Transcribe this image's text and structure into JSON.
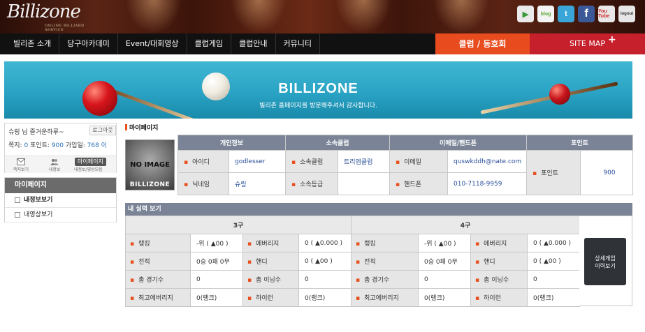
{
  "header": {
    "logo_text": "Billizone",
    "logo_sub": "ONLINE BILLIARD SERVICE",
    "social": [
      {
        "name": "play-store-icon",
        "glyph": "▶"
      },
      {
        "name": "blog-icon",
        "glyph": "blog"
      },
      {
        "name": "twitter-icon",
        "glyph": "t"
      },
      {
        "name": "facebook-icon",
        "glyph": "f"
      },
      {
        "name": "youtube-icon",
        "glyph": "You Tube"
      },
      {
        "name": "logout-icon",
        "glyph": "logout"
      }
    ]
  },
  "nav": {
    "items": [
      "빌리존 소개",
      "당구아카데미",
      "Event/대회영상",
      "클럽게임",
      "클럽안내",
      "커뮤니티"
    ],
    "club": "클럽 / 동호회",
    "sitemap": "SITE MAP",
    "sitemap_plus": "+"
  },
  "banner": {
    "title": "BILLIZONE",
    "subtitle": "빌리존 홈페이지를 방문해주셔서 감사합니다."
  },
  "user": {
    "greeting": "슈링 님 즐거운하루~",
    "logout": "로그아웃",
    "note_label": "쪽지:",
    "note_count": "0",
    "point_label": "포인트:",
    "point": "900",
    "join_label": "가입일:",
    "join_date": "768 이",
    "tools": [
      "쪽지보기",
      "내정보",
      "마이페이지"
    ],
    "mypage_sub": "내정보/영상모음"
  },
  "sidemenu": {
    "head": "마이페이지",
    "items": [
      "내정보보기",
      "내영상보기"
    ]
  },
  "section_title": "마이페이지",
  "noimage": {
    "line1": "NO IMAGE",
    "line2": "BILLIZONE"
  },
  "info": {
    "headers": [
      "개인정보",
      "소속클럽",
      "이메일/핸드폰",
      "포인트"
    ],
    "labels": {
      "id": "아이디",
      "nick": "닉네임",
      "club": "소속클럽",
      "club_grade": "소속등급",
      "email": "이메일",
      "phone": "핸드폰",
      "point": "포인트"
    },
    "id": "godlesser",
    "nick": "슈링",
    "club": "트리엠클럽",
    "email": "quswkddh@nate.com",
    "phone": "010-7118-9959",
    "point": "900"
  },
  "record": {
    "title": "내 실력 보기",
    "col3": "3구",
    "col4": "4구",
    "labels": [
      "랭킹",
      "에버리지",
      "전적",
      "핸디",
      "총 경기수",
      "총 이닝수",
      "최고에버리지",
      "하이런"
    ],
    "three": {
      "rank": "-위 ( ▲00 )",
      "avg": "0 ( ▲0.000 )",
      "record": "0승 0패 0무",
      "handi": "0 ( ▲00 )",
      "games": "0",
      "innings": "0",
      "best_avg": "0(랭크)",
      "highrun": "0(랭크)"
    },
    "four": {
      "rank": "-위 ( ▲00 )",
      "avg": "0 ( ▲0.000 )",
      "record": "0승 0패 0무",
      "handi": "0 ( ▲00 )",
      "games": "0",
      "innings": "0",
      "best_avg": "0(랭크)",
      "highrun": "0(랭크)"
    },
    "detail_btn_1": "상세게임",
    "detail_btn_2": "이력보기"
  }
}
